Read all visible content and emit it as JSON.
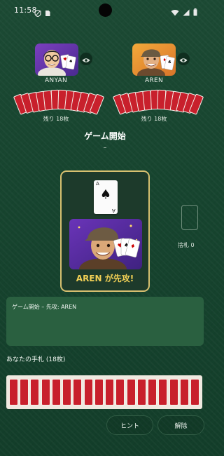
{
  "status_bar": {
    "time": "11:58"
  },
  "opponents": [
    {
      "name": "ANYAN",
      "remaining": "残り 18枚",
      "visibility_icon": "eye-icon"
    },
    {
      "name": "AREN",
      "remaining": "残り 18枚",
      "visibility_icon": "eye-icon"
    }
  ],
  "game": {
    "title": "ゲーム開始",
    "subtitle": "–",
    "top_card": {
      "rank": "A",
      "suit": "♠"
    },
    "first_move_message": "AREN が先攻!",
    "discard_label": "捨札 0"
  },
  "log": {
    "lines": [
      "ゲーム開始 – 先攻: AREN"
    ]
  },
  "hand": {
    "label": "あなたの手札 (18枚)",
    "card_count": 18
  },
  "buttons": {
    "hint": "ヒント",
    "release": "解除"
  },
  "colors": {
    "table_green": "#17452f",
    "card_back_red": "#c8202c",
    "panel_gold": "#d8c070",
    "message_gold": "#f0cf55",
    "log_green": "#2a6040"
  }
}
